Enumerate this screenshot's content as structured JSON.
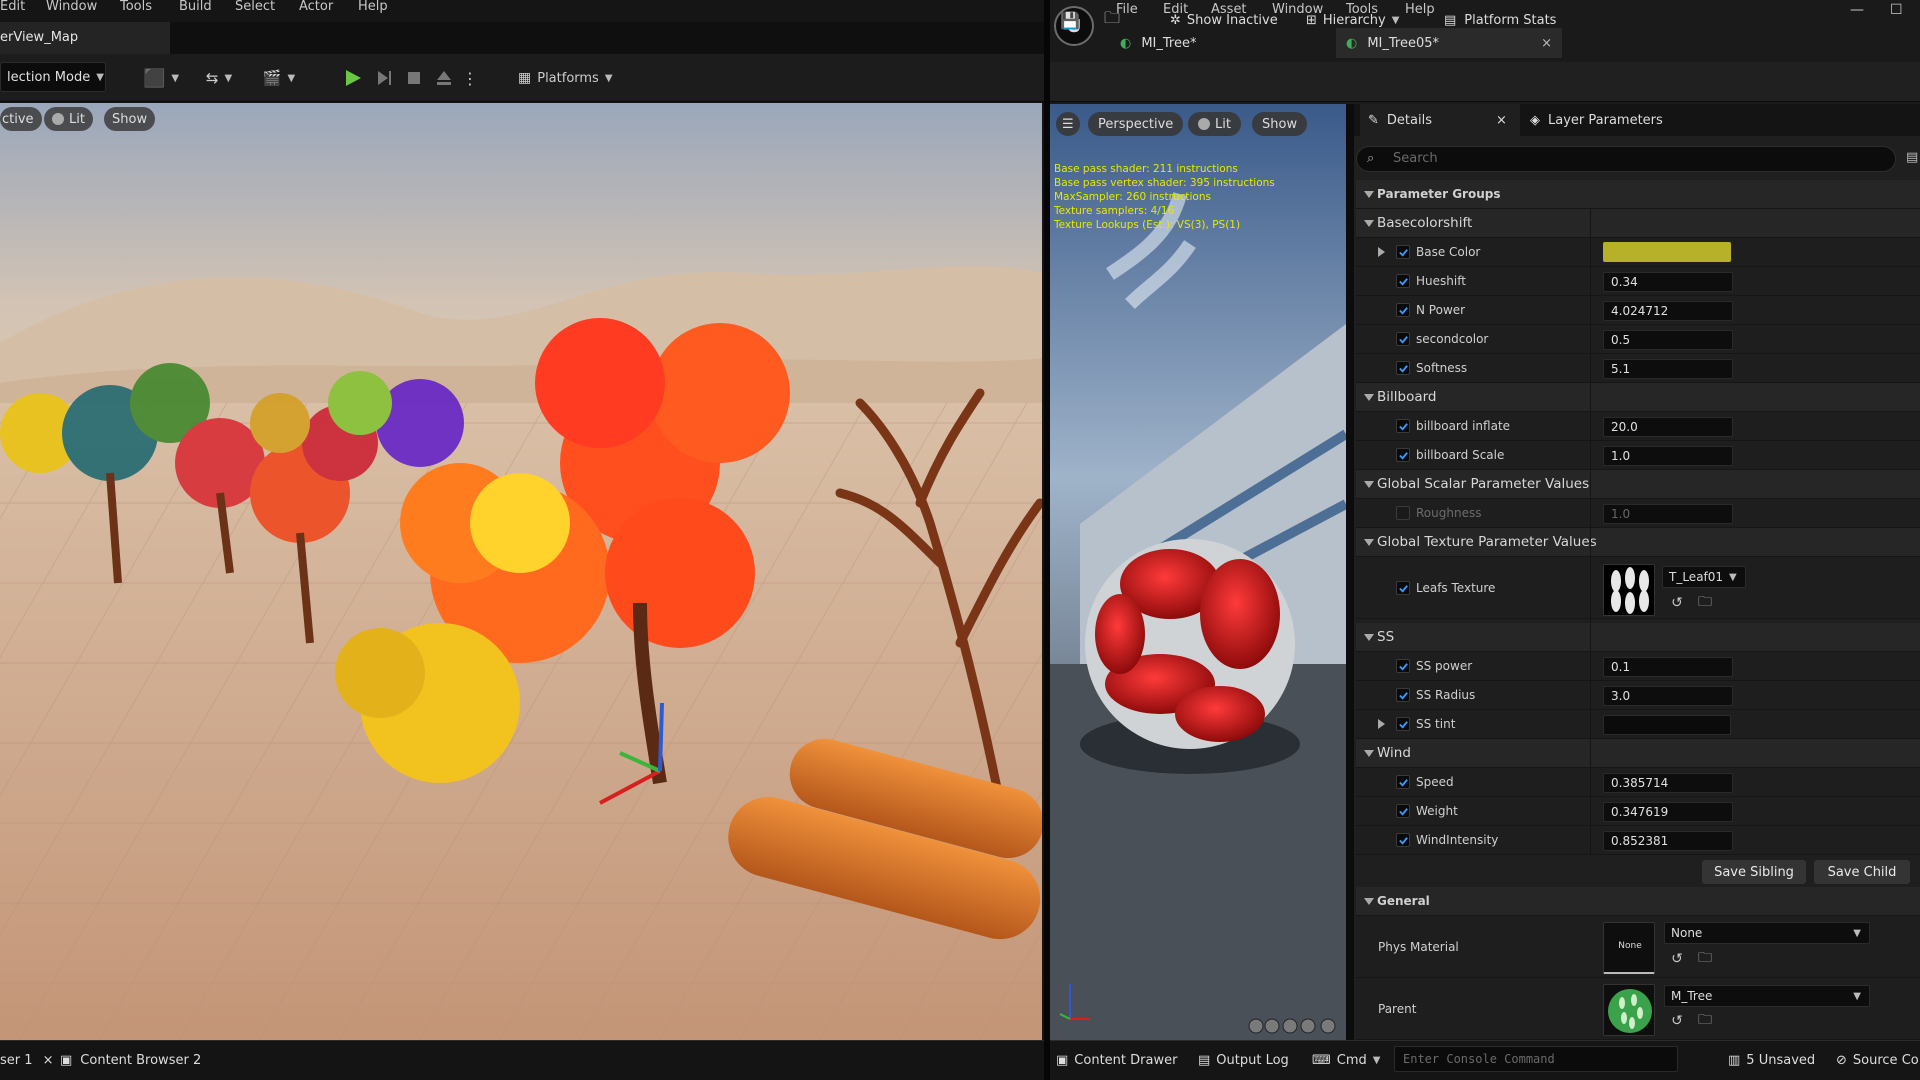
{
  "left_editor": {
    "menu": [
      "Edit",
      "Window",
      "Tools",
      "Build",
      "Select",
      "Actor",
      "Help"
    ],
    "map_tab": "erView_Map",
    "mode_dropdown": "lection Mode",
    "platforms_label": "Platforms",
    "viewport_pills": [
      "ctive",
      "Lit",
      "Show"
    ],
    "bottom_tabs": [
      "ser 1",
      "Content Browser 2"
    ]
  },
  "material_editor": {
    "menu": [
      "File",
      "Edit",
      "Asset",
      "Window",
      "Tools",
      "Help"
    ],
    "tabs": [
      "MI_Tree*",
      "MI_Tree05*"
    ],
    "toolbar": {
      "show_inactive": "Show Inactive",
      "hierarchy": "Hierarchy",
      "platform_stats": "Platform Stats"
    },
    "preview": {
      "pills": [
        "Perspective",
        "Lit",
        "Show"
      ],
      "stats": [
        "Base pass shader: 211 instructions",
        "Base pass vertex shader: 395 instructions",
        "MaxSampler: 260 instructions",
        "Texture samplers: 4/16",
        "Texture Lookups (Est.): VS(3), PS(1)"
      ]
    },
    "details_tab": "Details",
    "layer_tab": "Layer Parameters",
    "search_placeholder": "Search",
    "param_groups_header": "Parameter Groups",
    "groups": {
      "basecolorshift": {
        "title": "Basecolorshift",
        "base_color": {
          "label": "Base Color",
          "color": "#b7b12a"
        },
        "hueshift": {
          "label": "Hueshift",
          "value": "0.34"
        },
        "npower": {
          "label": "N Power",
          "value": "4.024712"
        },
        "secondcolor": {
          "label": "secondcolor",
          "value": "0.5"
        },
        "softness": {
          "label": "Softness",
          "value": "5.1"
        }
      },
      "billboard": {
        "title": "Billboard",
        "inflate": {
          "label": "billboard inflate",
          "value": "20.0"
        },
        "scale": {
          "label": "billboard Scale",
          "value": "1.0"
        }
      },
      "global_scalar": {
        "title": "Global Scalar Parameter Values",
        "roughness": {
          "label": "Roughness",
          "value": "1.0"
        }
      },
      "global_texture": {
        "title": "Global Texture Parameter Values",
        "leafs": {
          "label": "Leafs Texture",
          "asset": "T_Leaf01"
        }
      },
      "ss": {
        "title": "SS",
        "power": {
          "label": "SS power",
          "value": "0.1"
        },
        "radius": {
          "label": "SS Radius",
          "value": "3.0"
        },
        "tint": {
          "label": "SS tint",
          "color": "#0b0b0b"
        }
      },
      "wind": {
        "title": "Wind",
        "speed": {
          "label": "Speed",
          "value": "0.385714"
        },
        "weight": {
          "label": "Weight",
          "value": "0.347619"
        },
        "intensity": {
          "label": "WindIntensity",
          "value": "0.852381"
        }
      }
    },
    "buttons": {
      "save_sibling": "Save Sibling",
      "save_child": "Save Child"
    },
    "general": {
      "title": "General",
      "phys_material": {
        "label": "Phys Material",
        "thumb": "None",
        "asset": "None"
      },
      "parent": {
        "label": "Parent",
        "asset": "M_Tree"
      }
    },
    "bottom": {
      "content_drawer": "Content Drawer",
      "output_log": "Output Log",
      "cmd": "Cmd",
      "console_placeholder": "Enter Console Command",
      "unsaved": "5 Unsaved",
      "source_control": "Source Co"
    }
  }
}
